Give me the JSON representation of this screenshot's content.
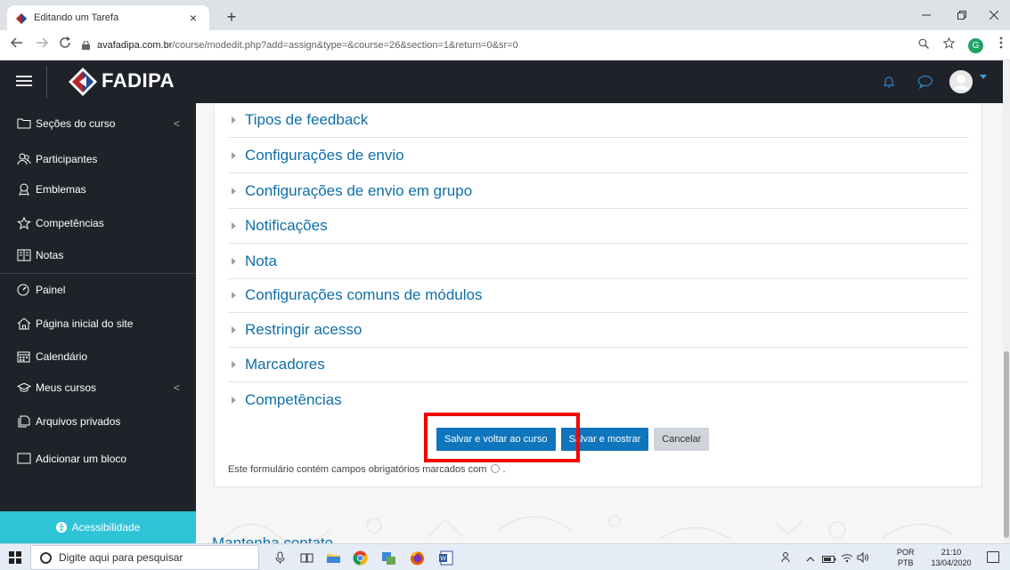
{
  "browser": {
    "tab_title": "Editando um Tarefa",
    "tab_close": "×",
    "new_tab": "+",
    "url_host": "avafadipa.com.br",
    "url_path": "/course/modedit.php?add=assign&type=&course=26&section=1&return=0&sr=0",
    "profile_initial": "G"
  },
  "header": {
    "brand": "FADIPA"
  },
  "sidebar": {
    "items": [
      {
        "label": "Seções do curso",
        "icon": "folder-icon",
        "has_chevron": true
      },
      {
        "label": "Participantes",
        "icon": "users-icon"
      },
      {
        "label": "Emblemas",
        "icon": "badge-icon"
      },
      {
        "label": "Competências",
        "icon": "star-icon"
      },
      {
        "label": "Notas",
        "icon": "grades-icon"
      },
      {
        "label": "Painel",
        "icon": "dashboard-icon"
      },
      {
        "label": "Página inicial do site",
        "icon": "home-icon"
      },
      {
        "label": "Calendário",
        "icon": "calendar-icon"
      },
      {
        "label": "Meus cursos",
        "icon": "graduation-cap-icon",
        "has_chevron": true
      },
      {
        "label": "Arquivos privados",
        "icon": "files-icon"
      },
      {
        "label": "Adicionar um bloco",
        "icon": "add-block-icon"
      }
    ],
    "chevron": "<",
    "accessibility": "Acessibilidade"
  },
  "form": {
    "sections": [
      "Tipos de feedback",
      "Configurações de envio",
      "Configurações de envio em grupo",
      "Notificações",
      "Nota",
      "Configurações comuns de módulos",
      "Restringir acesso",
      "Marcadores",
      "Competências"
    ],
    "buttons": {
      "save_return": "Salvar e voltar ao curso",
      "save_display": "Salvar e mostrar",
      "cancel": "Cancelar"
    },
    "required_note": "Este formulário contém campos obrigatórios marcados com",
    "note_end": ".",
    "footer_peek": "Mantenha contato"
  },
  "taskbar": {
    "search_placeholder": "Digite aqui para pesquisar",
    "lang_top": "POR",
    "lang_bottom": "PTB",
    "time": "21:10",
    "date": "13/04/2020"
  },
  "colors": {
    "sidebar_bg": "#1f2329",
    "link_blue": "#0f6fa8",
    "primary_button": "#0f75bd",
    "accessibility_bg": "#2fc3d7",
    "highlight_red": "#f20000"
  }
}
